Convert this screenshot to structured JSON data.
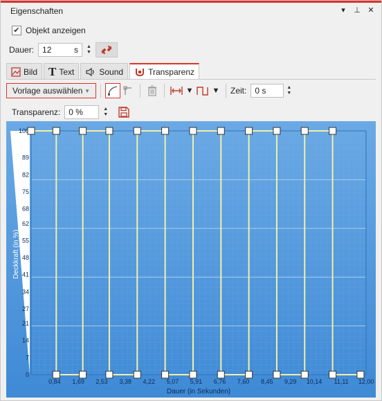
{
  "window": {
    "title": "Eigenschaften",
    "icons": [
      "dropdown-icon",
      "pin-icon",
      "close-icon"
    ]
  },
  "show_object": {
    "label": "Objekt anzeigen",
    "checked": true
  },
  "duration": {
    "label": "Dauer:",
    "value": "12",
    "unit": "s"
  },
  "tabs": [
    {
      "label": "Bild",
      "icon": "image-icon",
      "active": false
    },
    {
      "label": "Text",
      "icon": "text-icon",
      "active": false
    },
    {
      "label": "Sound",
      "icon": "speaker-icon",
      "active": false
    },
    {
      "label": "Transparenz",
      "icon": "transparency-icon",
      "active": true
    }
  ],
  "toolbar": {
    "template_select": "Vorlage auswählen",
    "time_label": "Zeit:",
    "time_value": "0 s"
  },
  "transparency": {
    "label": "Transparenz:",
    "value": "0 %"
  },
  "colors": {
    "accent": "#d9342b",
    "chart_bg": "#4f97dc",
    "curve": "#f2f0a8"
  },
  "chart_data": {
    "type": "line",
    "xlabel": "Dauer (in Sekunden)",
    "ylabel": "Deckkraft (in %)",
    "xlim": [
      0,
      12
    ],
    "ylim": [
      0,
      100
    ],
    "x_ticks": [
      "0,84",
      "1,69",
      "2,53",
      "3,38",
      "4,22",
      "5,07",
      "5,91",
      "6,76",
      "7,60",
      "8,45",
      "9,29",
      "10,14",
      "11,11",
      "12,00"
    ],
    "x_tick_values": [
      0.84,
      1.69,
      2.53,
      3.38,
      4.22,
      5.07,
      5.91,
      6.76,
      7.6,
      8.45,
      9.29,
      10.14,
      11.11,
      12.0
    ],
    "y_ticks": [
      "0",
      "7",
      "14",
      "21",
      "27",
      "34",
      "41",
      "48",
      "55",
      "62",
      "68",
      "75",
      "82",
      "89",
      "100"
    ],
    "y_tick_values": [
      0,
      7,
      14,
      21,
      27,
      34,
      41,
      48,
      55,
      62,
      68,
      75,
      82,
      89,
      100
    ],
    "grid": true,
    "series": [
      {
        "x": [
          0,
          0.9,
          0.9,
          1.85,
          1.85,
          2.8,
          2.8,
          3.8,
          3.8,
          4.8,
          4.8,
          5.8,
          5.8,
          6.8,
          6.8,
          7.8,
          7.8,
          8.8,
          8.8,
          9.8,
          9.8,
          10.8,
          10.8,
          11.8
        ],
        "y": [
          100,
          100,
          0,
          0,
          100,
          100,
          0,
          0,
          100,
          100,
          0,
          0,
          100,
          100,
          0,
          0,
          100,
          100,
          0,
          0,
          100,
          100,
          0,
          0
        ]
      }
    ]
  }
}
